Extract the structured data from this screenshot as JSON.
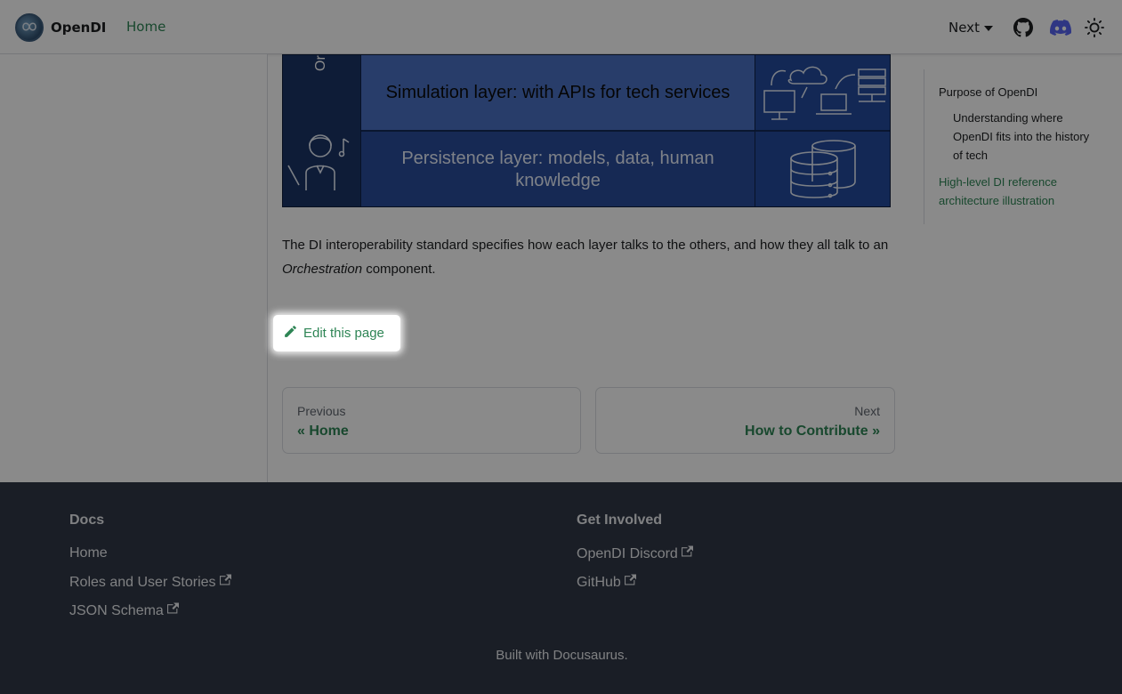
{
  "navbar": {
    "brand": "OpenDI",
    "home_link": "Home",
    "version_dropdown": "Next",
    "icons": [
      "github-icon",
      "discord-icon",
      "theme-toggle-icon"
    ]
  },
  "diagram": {
    "orchestration_label": "Or",
    "simulation_layer": "Simulation layer: with APIs for tech services",
    "persistence_layer": "Persistence layer: models, data, human knowledge"
  },
  "content": {
    "paragraph_start": "The DI interoperability standard specifies how each layer talks to the others, and how they all talk to an ",
    "paragraph_emphasis": "Orchestration",
    "paragraph_end": " component."
  },
  "edit_link": "Edit this page",
  "pagination": {
    "prev_sublabel": "Previous",
    "prev_label": "« Home",
    "next_sublabel": "Next",
    "next_label": "How to Contribute »"
  },
  "toc": {
    "items": [
      "Purpose of OpenDI",
      "Understanding where OpenDI fits into the history of tech",
      "High-level DI reference architecture illustration"
    ]
  },
  "footer": {
    "docs_title": "Docs",
    "docs_links": [
      "Home",
      "Roles and User Stories",
      "JSON Schema"
    ],
    "involved_title": "Get Involved",
    "involved_links": [
      "OpenDI Discord",
      "GitHub"
    ],
    "copyright": "Built with Docusaurus."
  },
  "colors": {
    "primary": "#2e8555",
    "footer_bg": "#303846",
    "diagram_dark": "#1a3466",
    "diagram_light": "#4a72c4"
  }
}
